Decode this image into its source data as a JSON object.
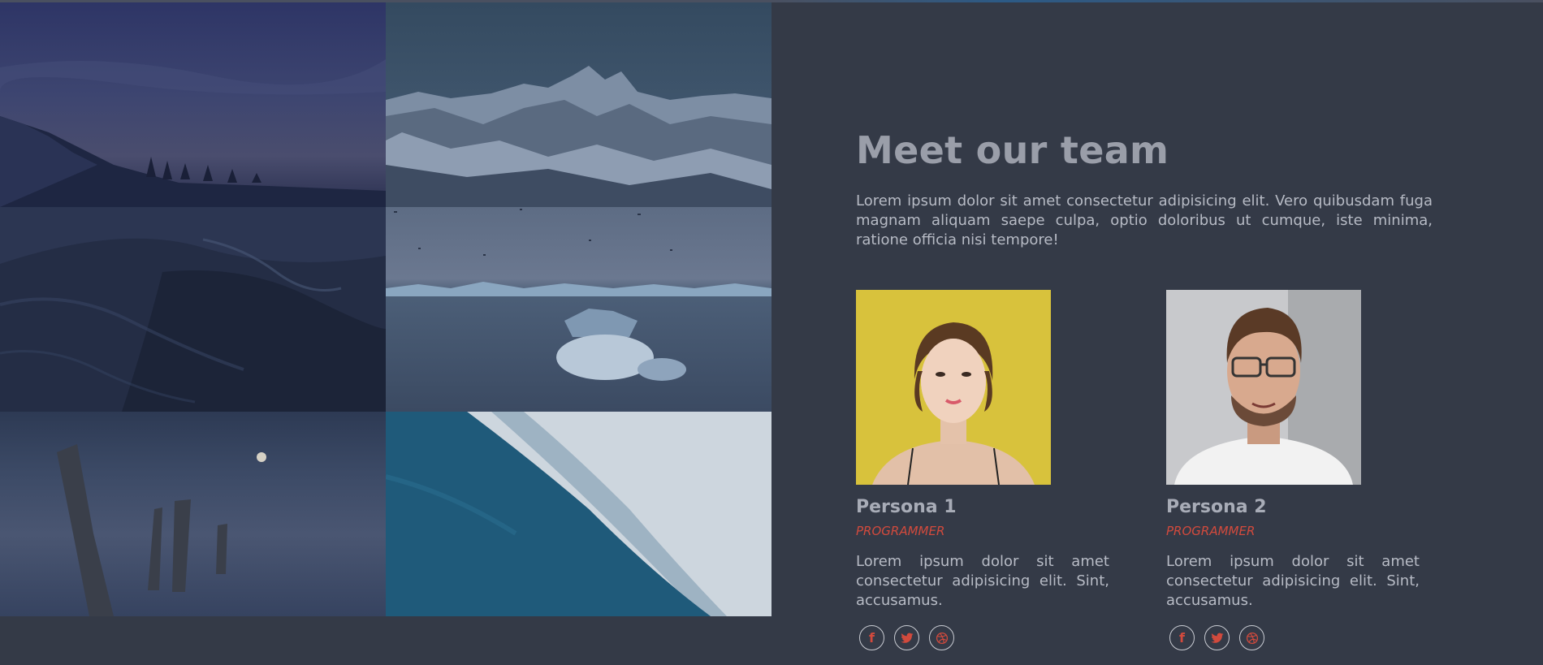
{
  "team": {
    "heading": "Meet our team",
    "intro": "Lorem ipsum dolor sit amet consectetur adipisicing elit. Vero quibusdam fuga magnam aliquam saepe culpa, optio doloribus ut cumque, iste minima, ratione officia nisi tempore!",
    "members": [
      {
        "name": "Persona 1",
        "role": "PROGRAMMER",
        "description": "Lorem ipsum dolor sit amet consectetur adipisicing elit. Sint, accusamus.",
        "socials": [
          "facebook-icon",
          "twitter-icon",
          "dribbble-icon"
        ]
      },
      {
        "name": "Persona 2",
        "role": "PROGRAMMER",
        "description": "Lorem ipsum dolor sit amet consectetur adipisicing elit. Sint, accusamus.",
        "socials": [
          "facebook-icon",
          "twitter-icon",
          "dribbble-icon"
        ]
      }
    ]
  },
  "gallery": {
    "images": [
      "forest-hill-night",
      "snowy-mountain",
      "dark-sea-rocks",
      "iceberg-sea-birds",
      "lake-tree-stumps",
      "ocean-wave-aerial"
    ]
  },
  "colors": {
    "background": "#343a47",
    "accent": "#d24a3d",
    "heading": "#9a9ea9",
    "text": "#b7bbc5"
  }
}
